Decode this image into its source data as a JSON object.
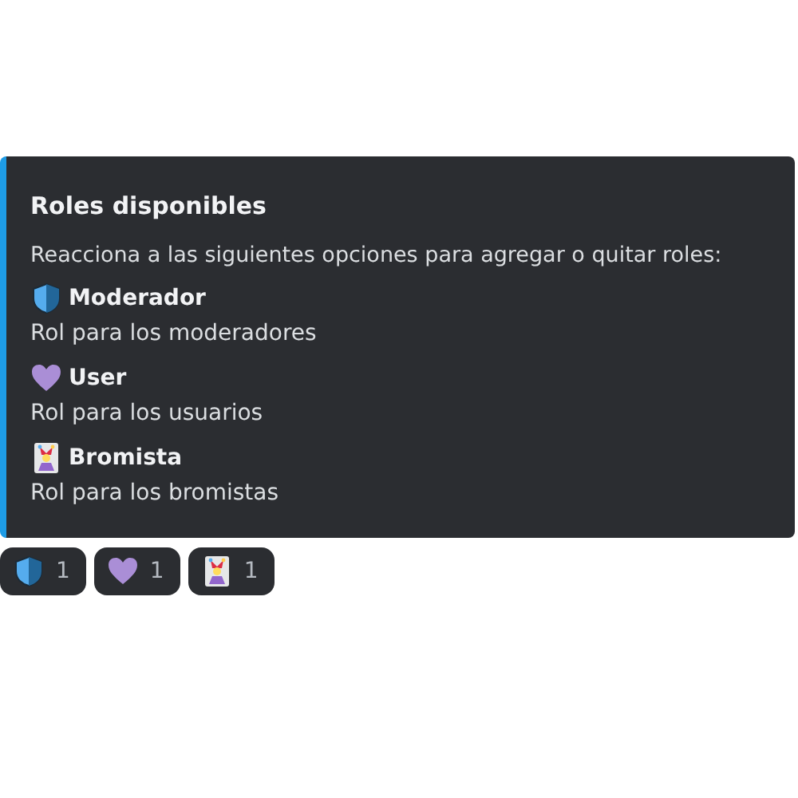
{
  "embed": {
    "title": "Roles disponibles",
    "description": "Reacciona a las siguientes opciones para agregar o quitar roles:",
    "roles": [
      {
        "kind": "shield",
        "name": "Moderador",
        "description": "Rol para los moderadores"
      },
      {
        "kind": "heart",
        "name": "User",
        "description": "Rol para los usuarios"
      },
      {
        "kind": "jester",
        "name": "Bromista",
        "description": "Rol para los bromistas"
      }
    ]
  },
  "reactions": [
    {
      "kind": "shield",
      "count": "1"
    },
    {
      "kind": "heart",
      "count": "1"
    },
    {
      "kind": "jester",
      "count": "1"
    }
  ]
}
